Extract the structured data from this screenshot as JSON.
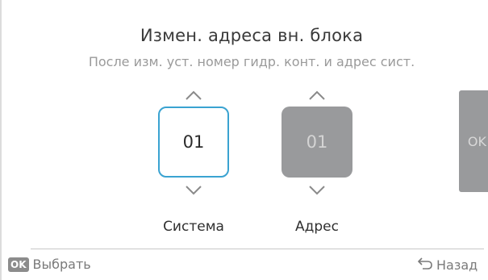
{
  "header": {
    "title": "Измен. адреса вн. блока",
    "subtitle": "После изм. уст. номер гидр. конт. и адрес сист."
  },
  "spinners": [
    {
      "label": "Система",
      "value": "01",
      "state": "active",
      "up_icon": "chevron-up-icon",
      "down_icon": "chevron-down-icon"
    },
    {
      "label": "Адрес",
      "value": "01",
      "state": "inactive",
      "up_icon": "chevron-up-icon",
      "down_icon": "chevron-down-icon"
    }
  ],
  "ok_button": {
    "label": "OK"
  },
  "footer": {
    "select_badge": "OK",
    "select_label": "Выбрать",
    "back_icon": "back-arrow-icon",
    "back_label": "Назад"
  },
  "colors": {
    "accent": "#3aa3d1",
    "inactive_box": "#999a9c",
    "text": "#333333",
    "muted_text": "#9a9a9a"
  }
}
